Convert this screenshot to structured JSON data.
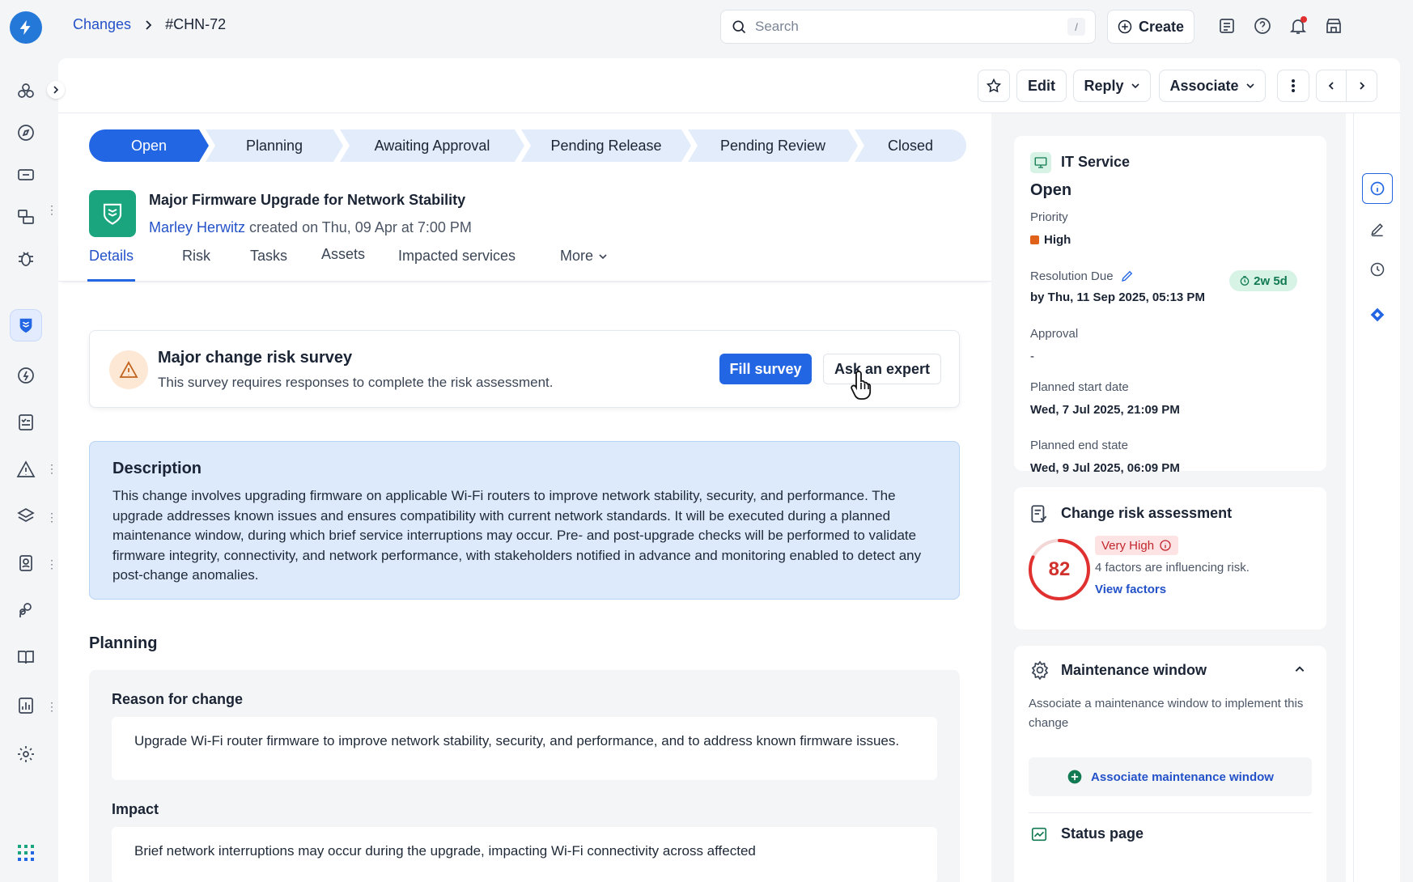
{
  "breadcrumb": {
    "parent": "Changes",
    "current": "#CHN-72"
  },
  "search": {
    "placeholder": "Search",
    "shortcut": "/"
  },
  "create": {
    "label": "Create"
  },
  "toolbar": {
    "edit": "Edit",
    "reply": "Reply",
    "associate": "Associate"
  },
  "stages": [
    {
      "label": "Open",
      "active": true
    },
    {
      "label": "Planning"
    },
    {
      "label": "Awaiting Approval"
    },
    {
      "label": "Pending Release"
    },
    {
      "label": "Pending Review"
    },
    {
      "label": "Closed"
    }
  ],
  "change": {
    "title": "Major Firmware Upgrade for Network Stability",
    "author": "Marley Herwitz",
    "created": "created on Thu, 09 Apr at 7:00 PM"
  },
  "tabs": [
    "Details",
    "Risk",
    "Tasks",
    "Assets",
    "Impacted services",
    "More"
  ],
  "survey": {
    "title": "Major change risk survey",
    "description": "This survey requires responses to complete the risk assessment.",
    "fill_label": "Fill survey",
    "expert_label": "Ask an expert"
  },
  "description": {
    "heading": "Description",
    "body": "This change involves upgrading firmware on applicable Wi-Fi routers to improve network stability, security, and performance. The upgrade addresses known issues and ensures compatibility with current network standards. It will be executed during a planned maintenance window, during which brief service interruptions may occur. Pre- and post-upgrade checks will be performed to validate firmware integrity, connectivity, and network performance, with stakeholders notified in advance and monitoring enabled to detect any post-change anomalies."
  },
  "planning": {
    "heading": "Planning",
    "reason_label": "Reason for change",
    "reason_text": "Upgrade Wi-Fi router firmware to improve network stability, security, and performance, and to address known firmware issues.",
    "impact_label": "Impact",
    "impact_text": "Brief network interruptions may occur during the upgrade, impacting Wi-Fi connectivity across affected"
  },
  "properties": {
    "type": "IT Service",
    "status": "Open",
    "priority_label": "Priority",
    "priority": "High",
    "priority_color": "#e0621a",
    "resolution_label": "Resolution Due",
    "resolution_value": "by Thu, 11 Sep 2025, 05:13 PM",
    "resolution_badge": "2w 5d",
    "approval_label": "Approval",
    "approval_value": "-",
    "start_label": "Planned start date",
    "start_value": "Wed, 7 Jul 2025, 21:09 PM",
    "end_label": "Planned end state",
    "end_value": "Wed, 9 Jul 2025, 06:09 PM"
  },
  "risk": {
    "heading": "Change risk assessment",
    "score": "82",
    "score_fraction": 0.82,
    "level": "Very High",
    "factors_text": "4 factors are influencing risk.",
    "view_link": "View factors"
  },
  "maintenance": {
    "heading": "Maintenance window",
    "description": "Associate a maintenance window to implement this change",
    "action": "Associate maintenance window"
  },
  "status_page": {
    "heading": "Status page"
  },
  "colors": {
    "accent": "#2366e3",
    "brand_green": "#1aa57e",
    "risk_red": "#e0302f"
  }
}
